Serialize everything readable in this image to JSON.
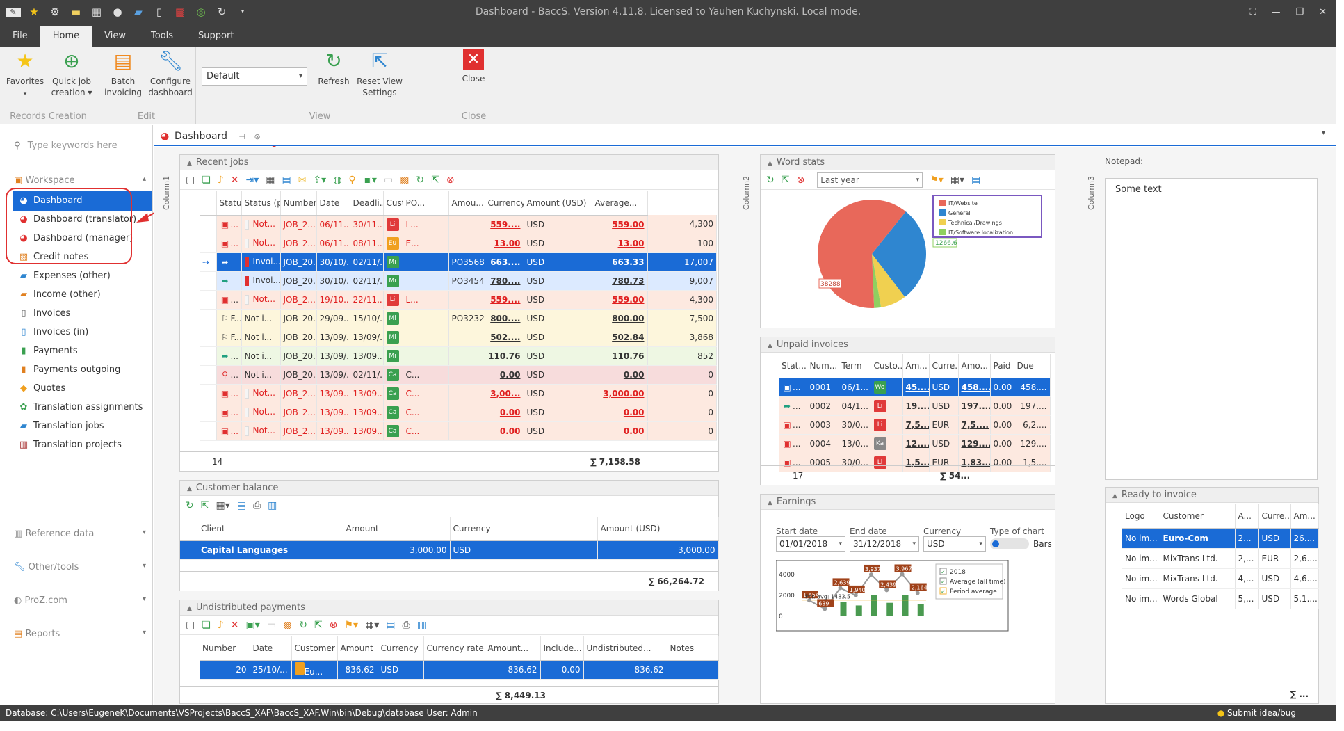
{
  "domain": "Computer-Use",
  "window": {
    "title": "Dashboard - BaccS. Version 4.11.8. Licensed to Yauhen Kuchynski. Local mode."
  },
  "menu_tabs": [
    "File",
    "Home",
    "View",
    "Tools",
    "Support"
  ],
  "ribbon": {
    "favorites": "Favorites",
    "quick_job_1": "Quick job",
    "quick_job_2": "creation",
    "batch_1": "Batch",
    "batch_2": "invoicing",
    "config_1": "Configure",
    "config_2": "dashboard",
    "view_value": "Default",
    "refresh": "Refresh",
    "reset_1": "Reset View",
    "reset_2": "Settings",
    "close": "Close",
    "g_records": "Records Creation",
    "g_edit": "Edit",
    "g_view": "View",
    "g_close": "Close"
  },
  "sidebar": {
    "search_placeholder": "Type keywords here",
    "workspace": "Workspace",
    "items": [
      "Dashboard",
      "Dashboard (translator)",
      "Dashboard (manager)",
      "Credit notes",
      "Expenses (other)",
      "Income (other)",
      "Invoices",
      "Invoices (in)",
      "Payments",
      "Payments outgoing",
      "Quotes",
      "Translation assignments",
      "Translation jobs",
      "Translation projects"
    ],
    "groups": [
      "Reference data",
      "Other/tools",
      "ProZ.com",
      "Reports"
    ]
  },
  "doc_tab": "Dashboard",
  "columns": {
    "c1": "Column1",
    "c2": "Column2",
    "c3": "Column3"
  },
  "recent_jobs": {
    "title": "Recent jobs",
    "headers": [
      "Statu...",
      "Status (p)",
      "Number...",
      "Date",
      "Deadli...",
      "Custo...",
      "PO...",
      "Amou...",
      "Currency",
      "Amount (USD)",
      "Average..."
    ],
    "rows": [
      [
        "...",
        "Not...",
        "JOB_2...",
        "06/11...",
        "30/11...",
        "Li",
        "L...",
        "",
        "559....",
        "USD",
        "559.00",
        "4,300"
      ],
      [
        "...",
        "Not...",
        "JOB_2...",
        "06/11...",
        "08/11...",
        "Eu",
        "E...",
        "",
        "13.00",
        "USD",
        "13.00",
        "100"
      ],
      [
        "",
        "Invoi...",
        "JOB_20...",
        "30/10/...",
        "02/11/...",
        "Mi",
        "",
        "PO3568...",
        "663....",
        "USD",
        "663.33",
        "17,007"
      ],
      [
        "",
        "Invoi...",
        "JOB_20...",
        "30/10/...",
        "02/11/...",
        "Mi",
        "",
        "PO34541",
        "780....",
        "USD",
        "780.73",
        "9,007"
      ],
      [
        "...",
        "Not...",
        "JOB_2...",
        "19/10...",
        "22/11...",
        "Li",
        "L...",
        "",
        "559....",
        "USD",
        "559.00",
        "4,300"
      ],
      [
        "F...",
        "Not i...",
        "JOB_20...",
        "29/09...",
        "15/10/...",
        "Mi",
        "",
        "PO3232",
        "800....",
        "USD",
        "800.00",
        "7,500"
      ],
      [
        "F...",
        "Not i...",
        "JOB_20...",
        "13/09/...",
        "13/09/...",
        "Mi",
        "",
        "",
        "502....",
        "USD",
        "502.84",
        "3,868"
      ],
      [
        "...",
        "Not i...",
        "JOB_20...",
        "13/09/...",
        "13/09...",
        "Mi",
        "",
        "",
        "110.76",
        "USD",
        "110.76",
        "852"
      ],
      [
        "...",
        "Not i...",
        "JOB_20...",
        "13/09/...",
        "02/11/...",
        "Ca",
        "C...",
        "",
        "0.00",
        "USD",
        "0.00",
        "0"
      ],
      [
        "...",
        "Not...",
        "JOB_2...",
        "13/09...",
        "13/09...",
        "Ca",
        "C...",
        "",
        "3,00...",
        "USD",
        "3,000.00",
        "0"
      ],
      [
        "...",
        "Not...",
        "JOB_2...",
        "13/09...",
        "13/09...",
        "Ca",
        "C...",
        "",
        "0.00",
        "USD",
        "0.00",
        "0"
      ],
      [
        "...",
        "Not...",
        "JOB_2...",
        "13/09...",
        "13/09...",
        "Ca",
        "C...",
        "",
        "0.00",
        "USD",
        "0.00",
        "0"
      ]
    ],
    "count": "14",
    "sum": "∑ 7,158.58"
  },
  "customer_balance": {
    "title": "Customer balance",
    "headers": [
      "Client",
      "Amount",
      "Currency",
      "Amount (USD)"
    ],
    "row": [
      "Capital Languages",
      "3,000.00",
      "USD",
      "3,000.00"
    ],
    "sum": "∑ 66,264.72"
  },
  "undistributed": {
    "title": "Undistributed payments",
    "headers": [
      "Number",
      "Date",
      "Customer",
      "Amount",
      "Currency",
      "Currency rate",
      "Amount...",
      "Include...",
      "Undistributed...",
      "Notes"
    ],
    "row": [
      "20",
      "25/10/...",
      "Eu...",
      "836.62",
      "USD",
      "",
      "836.62",
      "0.00",
      "836.62",
      ""
    ],
    "sum": "∑ 8,449.13"
  },
  "word_stats": {
    "title": "Word stats",
    "period": "Last year",
    "legend": [
      "IT/Website",
      "General",
      "Technical/Drawings",
      "IT/Software localization"
    ],
    "label_small": "1266.6",
    "label_big": "38288"
  },
  "chart_data": [
    {
      "type": "pie",
      "title": "Word stats",
      "categories": [
        "IT/Website",
        "General",
        "Technical/Drawings",
        "IT/Software localization"
      ],
      "values": [
        38288,
        18000,
        4800,
        1266.6
      ],
      "colors": [
        "#e8685a",
        "#2f86d0",
        "#f0d050",
        "#8fd060"
      ]
    },
    {
      "type": "bar",
      "title": "Earnings",
      "ylim": [
        0,
        4000
      ],
      "series": [
        {
          "name": "2018",
          "values": [
            1454,
            639,
            2639,
            1940,
            3937,
            2439,
            3967,
            2164
          ]
        }
      ],
      "average_label": "Per. avg: 1483.5"
    }
  ],
  "unpaid": {
    "title": "Unpaid invoices",
    "headers": [
      "Stat...",
      "Num...",
      "Term",
      "Custo...",
      "Am...",
      "Curre...",
      "Amo...",
      "Paid",
      "Due"
    ],
    "rows": [
      [
        "...",
        "0001",
        "06/1...",
        "Wo",
        "45....",
        "USD",
        "458....",
        "0.00",
        "458...."
      ],
      [
        "...",
        "0002",
        "04/1...",
        "Li",
        "19....",
        "USD",
        "197....",
        "0.00",
        "197...."
      ],
      [
        "...",
        "0003",
        "30/0...",
        "Li",
        "7,5...",
        "EUR",
        "7,5....",
        "0.00",
        "6,2...."
      ],
      [
        "...",
        "0004",
        "13/0...",
        "Ka",
        "12....",
        "USD",
        "129....",
        "0.00",
        "129...."
      ],
      [
        "...",
        "0005",
        "30/0...",
        "Li",
        "1,5...",
        "EUR",
        "1,83....",
        "0.00",
        "1,5...."
      ]
    ],
    "count": "17",
    "sum": "∑ 54..."
  },
  "earnings": {
    "title": "Earnings",
    "start_label": "Start date",
    "end_label": "End date",
    "currency_label": "Currency",
    "type_label": "Type of chart",
    "start": "01/01/2018",
    "end": "31/12/2018",
    "currency": "USD",
    "type_value": "Bars",
    "legend": [
      "2018",
      "Average (all time)",
      "Period average"
    ],
    "ticks": [
      "4000",
      "2000",
      "0"
    ],
    "bar_labels": [
      "1,454",
      "639",
      "2,639",
      "1,940",
      "3,937",
      "2,439",
      "3,967",
      "2,164"
    ],
    "avg_label": "Per. avg: 1483.5"
  },
  "notepad": {
    "title": "Notepad:",
    "text": "Some text"
  },
  "ready": {
    "title": "Ready to invoice",
    "headers": [
      "Logo",
      "Customer",
      "A...",
      "Curre...",
      "Am..."
    ],
    "rows": [
      [
        "No im...",
        "Euro-Com",
        "2...",
        "USD",
        "26...."
      ],
      [
        "No im...",
        "MixTrans Ltd.",
        "2,...",
        "EUR",
        "2,6...."
      ],
      [
        "No im...",
        "MixTrans Ltd.",
        "4,...",
        "USD",
        "4,6...."
      ],
      [
        "No im...",
        "Words Global",
        "5,...",
        "USD",
        "5,1...."
      ]
    ],
    "sum": "∑ ..."
  },
  "status": {
    "left": "Database: C:\\Users\\EugeneK\\Documents\\VSProjects\\BaccS_XAF\\BaccS_XAF.Win\\bin\\Debug\\database   User: Admin",
    "right": "Submit idea/bug"
  }
}
